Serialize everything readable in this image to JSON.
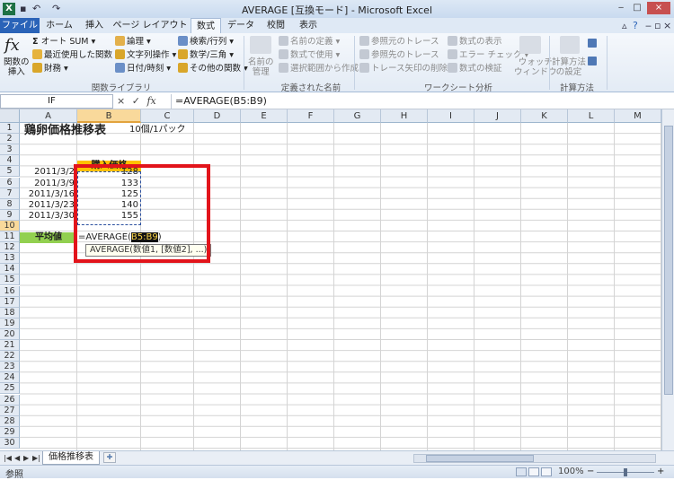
{
  "window": {
    "title": "AVERAGE [互換モード] - Microsoft Excel",
    "app_icon": "X",
    "minimize_icon": "minimize-icon",
    "maximize_icon": "maximize-icon",
    "close_icon": "close-icon"
  },
  "quick_access": {
    "save_icon": "save-icon",
    "undo_icon": "undo-icon",
    "redo_icon": "redo-icon"
  },
  "tabs": [
    {
      "label": "ファイル"
    },
    {
      "label": "ホーム"
    },
    {
      "label": "挿入"
    },
    {
      "label": "ページ レイアウト"
    },
    {
      "label": "数式"
    },
    {
      "label": "データ"
    },
    {
      "label": "校閲"
    },
    {
      "label": "表示"
    }
  ],
  "ribbon": {
    "function_library": {
      "label": "関数ライブラリ",
      "insert_function": "関数の\n挿入",
      "autosum": "オート SUM",
      "recent": "最近使用した関数",
      "financial": "財務",
      "logical": "論理",
      "text": "文字列操作",
      "datetime": "日付/時刻",
      "lookup": "検索/行列",
      "math": "数学/三角",
      "other": "その他の関数"
    },
    "defined_names": {
      "label": "定義された名前",
      "name_manager": "名前の\n管理",
      "define_name": "名前の定義",
      "use_in_formula": "数式で使用",
      "create_from_selection": "選択範囲から作成"
    },
    "formula_auditing": {
      "label": "ワークシート分析",
      "trace_precedents": "参照元のトレース",
      "trace_dependents": "参照先のトレース",
      "remove_arrows": "トレース矢印の削除",
      "show_formulas": "数式の表示",
      "error_checking": "エラー チェック",
      "evaluate_formula": "数式の検証",
      "watch_window": "ウォッチ\nウィンドウ"
    },
    "calculation": {
      "label": "計算方法",
      "calc_options": "計算方法\nの設定"
    }
  },
  "formula_bar": {
    "name_box": "IF",
    "cancel_icon": "×",
    "enter_icon": "✓",
    "fx_icon": "fx",
    "formula": "=AVERAGE(B5:B9)"
  },
  "columns": [
    "A",
    "B",
    "C",
    "D",
    "E",
    "F",
    "G",
    "H",
    "I",
    "J",
    "K",
    "L",
    "M"
  ],
  "rows": [
    "1",
    "2",
    "3",
    "4",
    "5",
    "6",
    "7",
    "8",
    "9",
    "10",
    "11",
    "12",
    "13",
    "14",
    "15",
    "16",
    "17",
    "18",
    "19",
    "20",
    "21",
    "22",
    "23",
    "24",
    "25",
    "26",
    "27",
    "28",
    "29",
    "30"
  ],
  "sheet": {
    "title": "鶏卵価格推移表",
    "unit": "10個/1パック",
    "header": "購入価格",
    "dates": [
      "2011/3/2",
      "2011/3/9",
      "2011/3/16",
      "2011/3/23",
      "2011/3/30"
    ],
    "prices": [
      "128",
      "133",
      "125",
      "140",
      "155"
    ],
    "average_label": "平均値",
    "editing_prefix": "=AVERAGE(",
    "editing_ref": "B5:B9",
    "editing_suffix": ")",
    "tooltip": "AVERAGE(数値1, [数値2], ...)"
  },
  "sheet_tab": "価格推移表",
  "status": {
    "mode": "参照",
    "zoom": "100%"
  },
  "colors": {
    "header_fill": "#ffc000",
    "average_fill": "#92d050",
    "highlight": "#e2141b",
    "file_tab": "#2a63b8"
  }
}
